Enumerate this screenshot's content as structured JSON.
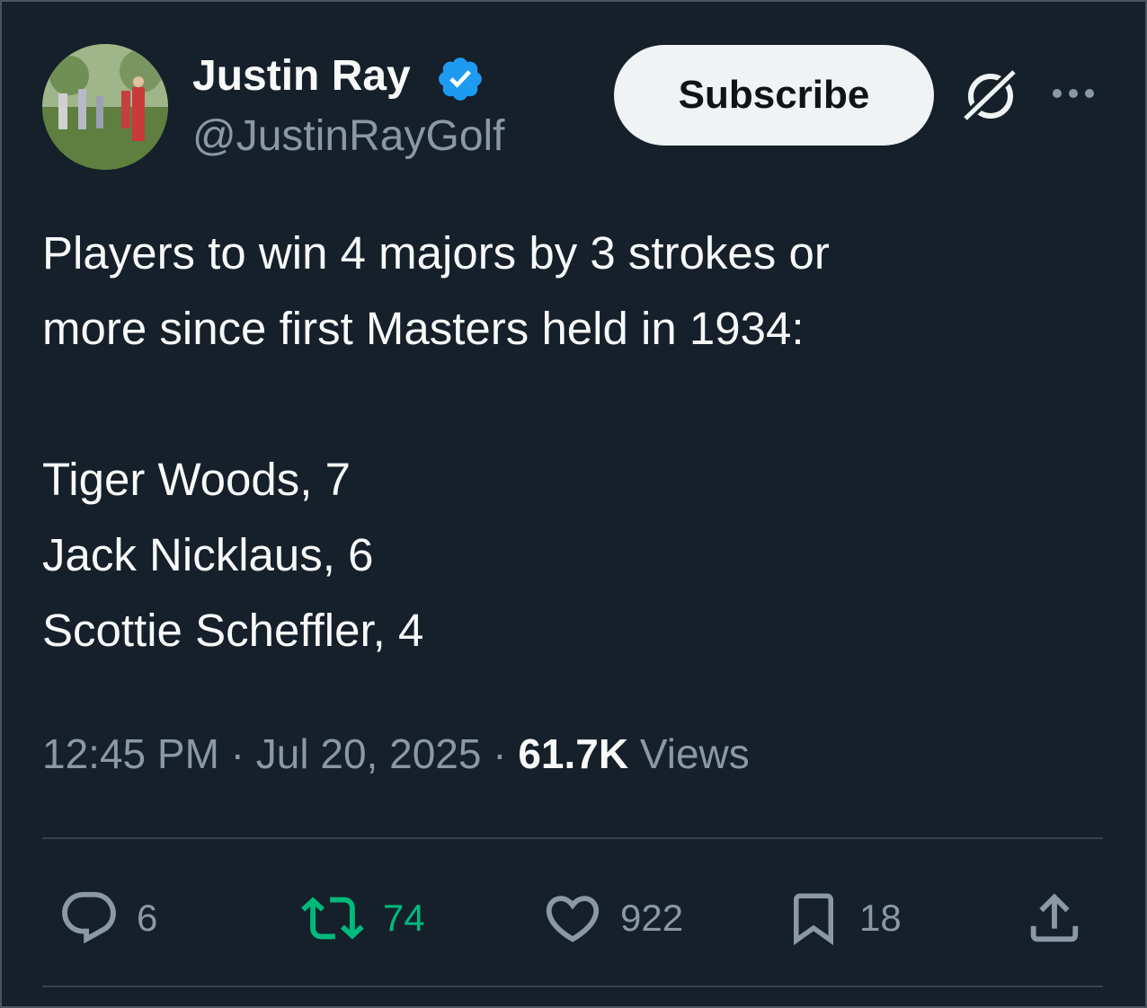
{
  "author": {
    "name": "Justin Ray",
    "handle": "@JustinRayGolf",
    "verified": true
  },
  "header": {
    "subscribe_label": "Subscribe",
    "grok_icon": "grok-icon",
    "more_icon": "more-dots-icon"
  },
  "tweet": {
    "lines": [
      "Players to win 4 majors by 3 strokes or",
      "more since first Masters held in 1934:",
      "",
      "Tiger Woods, 7",
      "Jack Nicklaus, 6",
      "Scottie Scheffler, 4"
    ]
  },
  "meta": {
    "time": "12:45 PM",
    "sep1": " · ",
    "date": "Jul 20, 2025",
    "sep2": " · ",
    "views_count": "61.7K",
    "views_label": " Views"
  },
  "actions": {
    "replies": "6",
    "reposts": "74",
    "likes": "922",
    "bookmarks": "18"
  },
  "colors": {
    "background": "#15202b",
    "text": "#f7f9f9",
    "muted": "#8b98a5",
    "verified": "#1d9bf0",
    "repost_active": "#00ba7c"
  }
}
